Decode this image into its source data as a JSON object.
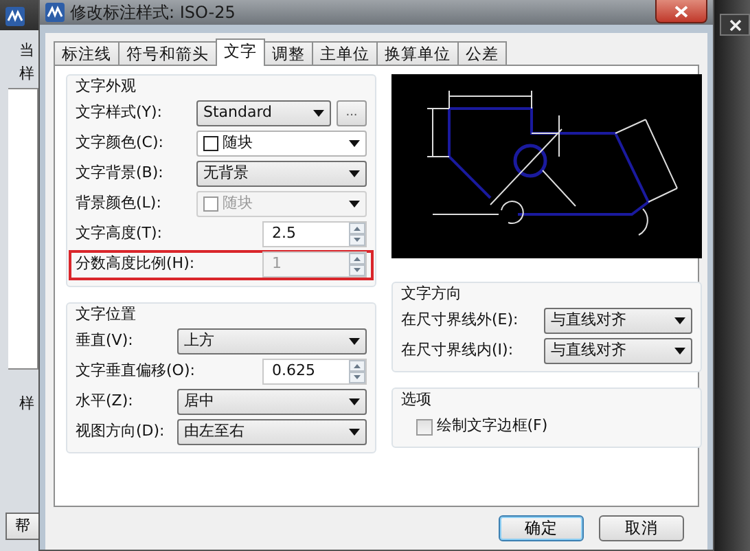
{
  "background_window": {
    "labels": [
      "当",
      "样"
    ],
    "lower_label": "样",
    "help_button": "帮"
  },
  "dialog": {
    "title": "修改标注样式: ISO-25"
  },
  "tabs": [
    {
      "label": "标注线",
      "selected": false
    },
    {
      "label": "符号和箭头",
      "selected": false
    },
    {
      "label": "文字",
      "selected": true
    },
    {
      "label": "调整",
      "selected": false
    },
    {
      "label": "主单位",
      "selected": false
    },
    {
      "label": "换算单位",
      "selected": false
    },
    {
      "label": "公差",
      "selected": false
    }
  ],
  "text_appearance": {
    "title": "文字外观",
    "rows": [
      {
        "kind": "select",
        "label": "文字样式(Y):",
        "value": "Standard",
        "disabled": false,
        "browse": "..."
      },
      {
        "kind": "color",
        "label": "文字颜色(C):",
        "value": "随块",
        "disabled": false
      },
      {
        "kind": "select",
        "label": "文字背景(B):",
        "value": "无背景",
        "disabled": false
      },
      {
        "kind": "color",
        "label": "背景颜色(L):",
        "value": "随块",
        "disabled": true
      },
      {
        "kind": "spin",
        "label": "文字高度(T):",
        "value": "2.5",
        "disabled": false,
        "highlighted": false
      },
      {
        "kind": "spin",
        "label": "分数高度比例(H):",
        "value": "1",
        "disabled": true,
        "highlighted": true
      }
    ]
  },
  "text_position": {
    "title": "文字位置",
    "rows": [
      {
        "kind": "select",
        "label": "垂直(V):",
        "value": "上方",
        "disabled": false
      },
      {
        "kind": "spin",
        "label": "文字垂直偏移(O):",
        "value": "0.625",
        "disabled": false
      },
      {
        "kind": "select",
        "label": "水平(Z):",
        "value": "居中",
        "disabled": false
      },
      {
        "kind": "select",
        "label": "视图方向(D):",
        "value": "由左至右",
        "disabled": false
      }
    ]
  },
  "text_direction": {
    "title": "文字方向",
    "rows": [
      {
        "kind": "select",
        "label": "在尺寸界线外(E):",
        "value": "与直线对齐",
        "disabled": false
      },
      {
        "kind": "select",
        "label": "在尺寸界线内(I):",
        "value": "与直线对齐",
        "disabled": false
      }
    ]
  },
  "options": {
    "title": "选项",
    "checkbox": {
      "label": "绘制文字边框(F)",
      "checked": false
    }
  },
  "buttons": [
    {
      "label": "确定",
      "default": true
    },
    {
      "label": "取消",
      "default": false
    }
  ]
}
